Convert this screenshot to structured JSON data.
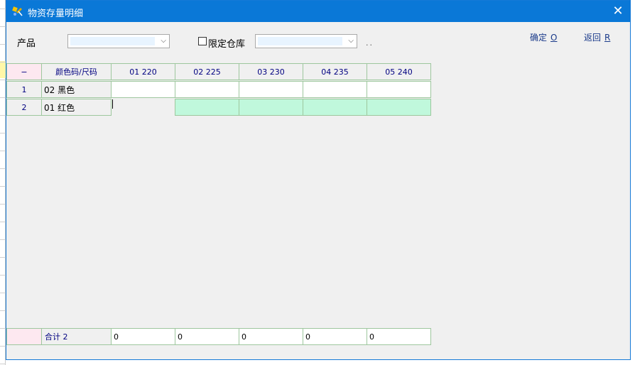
{
  "window": {
    "title": "物资存量明细",
    "close_glyph": "✕"
  },
  "filters": {
    "product_label": "产品",
    "product_value": "",
    "warehouse_checkbox_label": "限定仓库",
    "warehouse_checked": false,
    "warehouse_value": "",
    "ellipsis": ".."
  },
  "actions": {
    "ok_label": "确定",
    "ok_key": "O",
    "back_label": "返回",
    "back_key": "R"
  },
  "grid": {
    "corner": "−",
    "row_header_title": "颜色码/尺码",
    "columns": [
      "01 220",
      "02 225",
      "03 230",
      "04 235",
      "05 240"
    ],
    "rows": [
      {
        "index": "1",
        "label": "02 黑色",
        "values": [
          "",
          "",
          "",
          "",
          ""
        ]
      },
      {
        "index": "2",
        "label": "01 红色",
        "values": [
          "",
          "",
          "",
          "",
          ""
        ]
      }
    ],
    "total_label": "合计 2",
    "totals": [
      "0",
      "0",
      "0",
      "0",
      "0"
    ]
  }
}
